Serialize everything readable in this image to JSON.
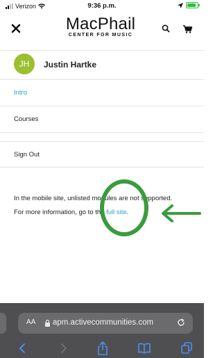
{
  "status_bar": {
    "carrier": "Verizon",
    "time": "9:36 p.m."
  },
  "header": {
    "logo_main": "MacPhail",
    "logo_sub": "CENTER FOR MUSIC",
    "icons": [
      "close-icon",
      "search-icon",
      "cart-icon"
    ]
  },
  "profile": {
    "initials": "JH",
    "name": "Justin Hartke",
    "avatar_color": "#9bbf2f"
  },
  "menu": {
    "items": [
      {
        "label": "Intro"
      },
      {
        "label": "Courses"
      },
      {
        "label": ""
      },
      {
        "label": "Sign Out"
      }
    ]
  },
  "notice": {
    "line1": "In the mobile site, unlisted modules are not supported.",
    "line2_prefix": "For more information, go to the ",
    "link_text": "full site",
    "line2_suffix": "."
  },
  "browser": {
    "text_size_label": "AA",
    "url": "apm.activecommunities.com"
  },
  "colors": {
    "link": "#2a9fd6",
    "annotation": "#3a9c3d",
    "safari_bar": "#4f4f52"
  }
}
